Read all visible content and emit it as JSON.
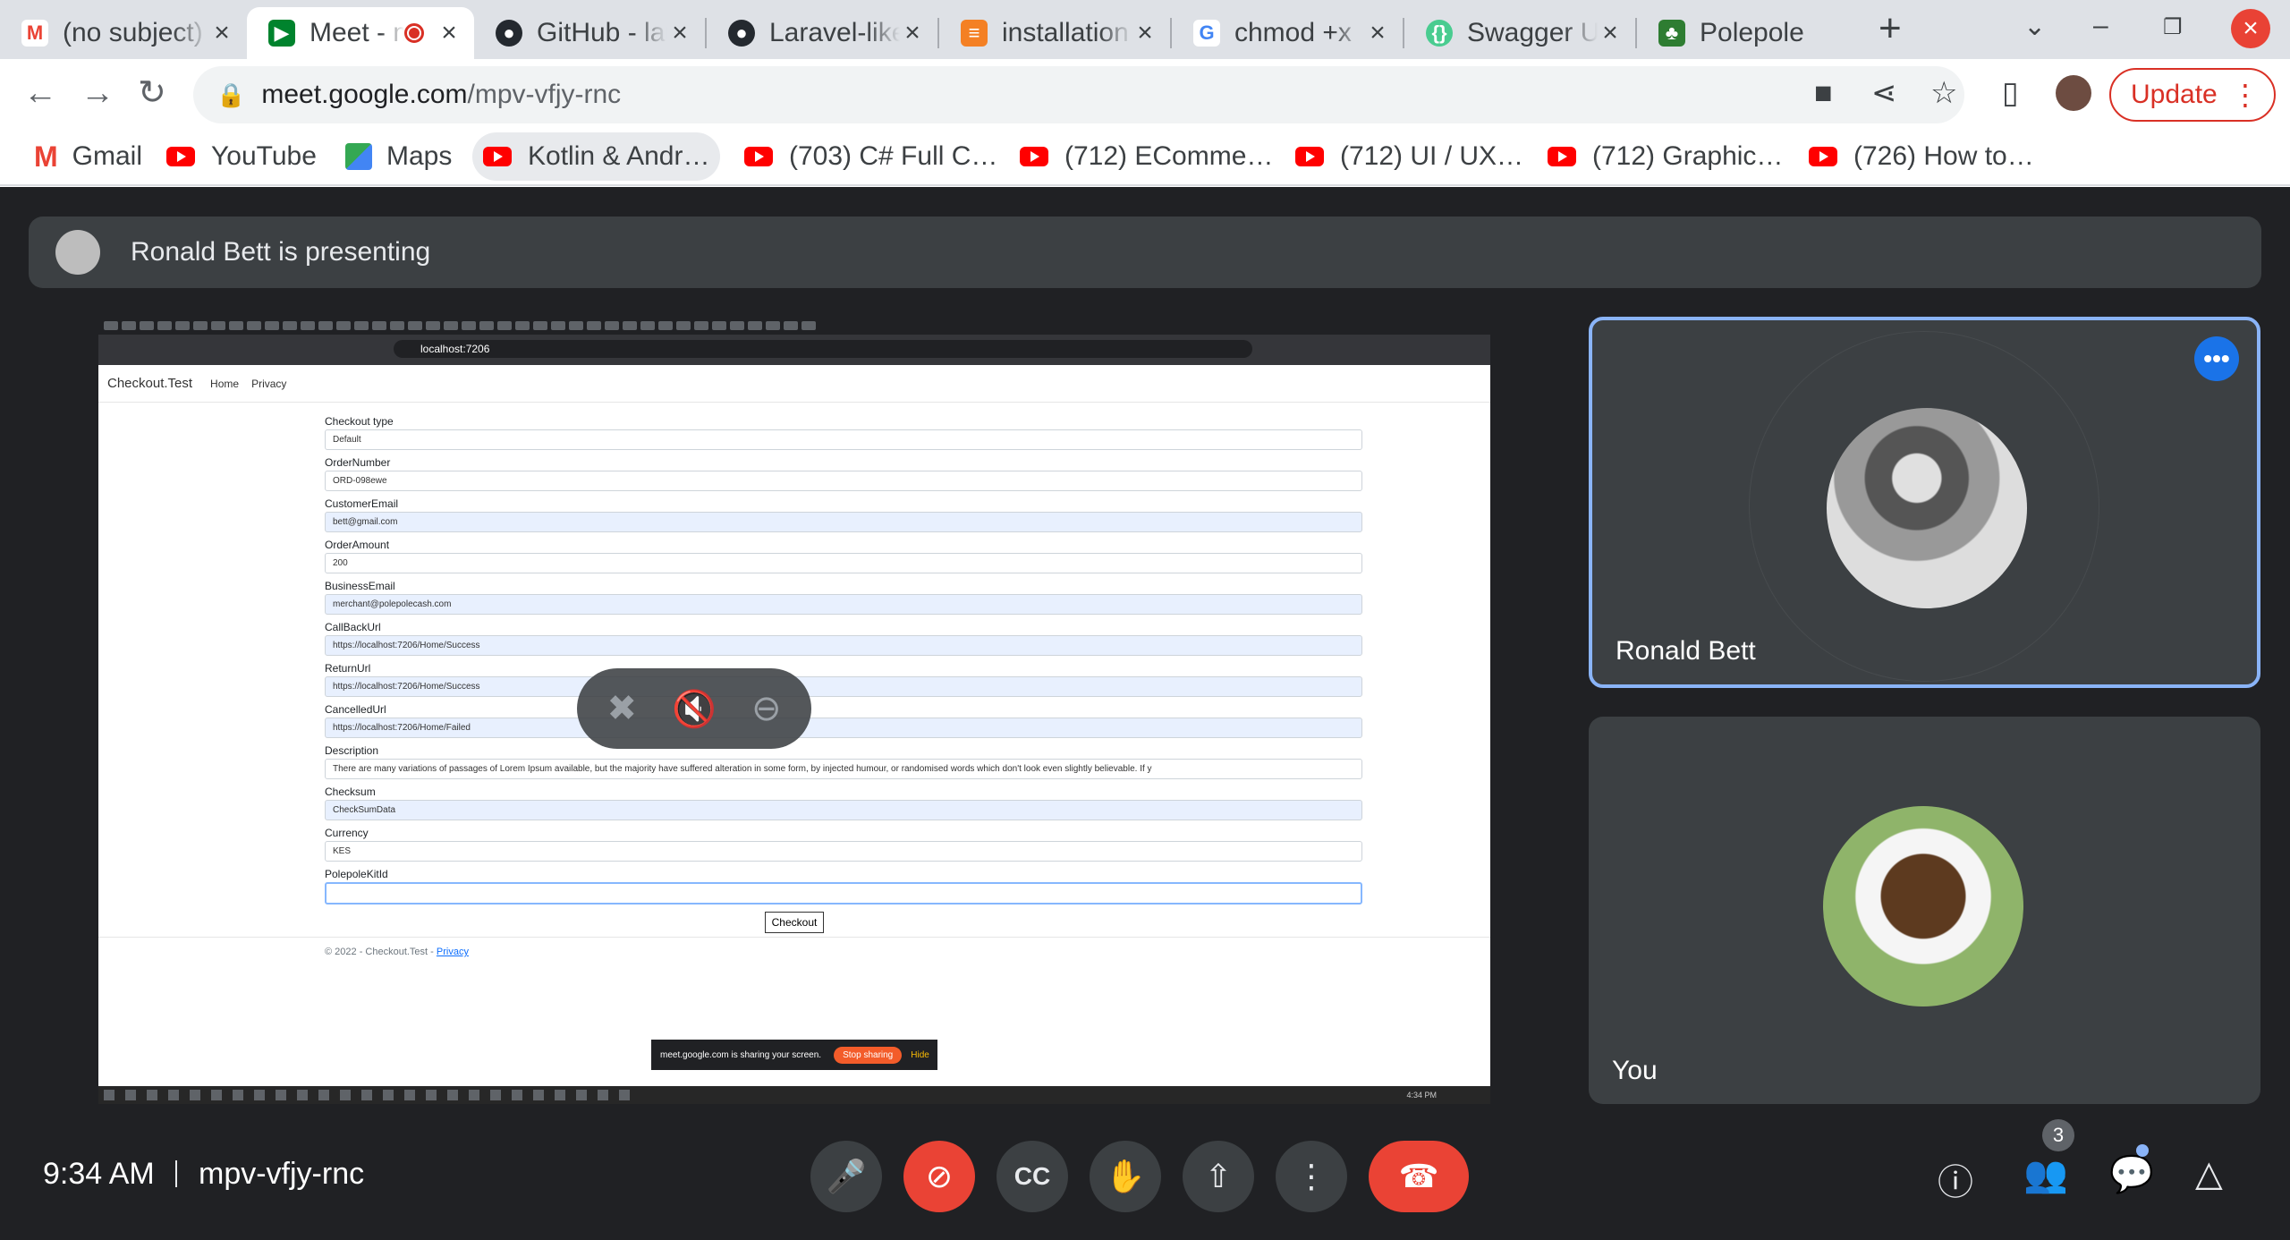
{
  "browser": {
    "tabs": [
      {
        "title": "(no subject)",
        "icon": "gmail-icon"
      },
      {
        "title": "Meet - mpv-vfjy-rnc",
        "icon": "meet-icon",
        "active": true
      },
      {
        "title": "GitHub - laravel",
        "icon": "github-icon"
      },
      {
        "title": "Laravel-like",
        "icon": "github-icon"
      },
      {
        "title": "installation",
        "icon": "stackoverflow-icon"
      },
      {
        "title": "chmod +x",
        "icon": "google-icon"
      },
      {
        "title": "Swagger UI",
        "icon": "swagger-icon"
      },
      {
        "title": "Polepole",
        "icon": "polepole-icon"
      }
    ],
    "url_host": "meet.google.com",
    "url_path": "/mpv-vfjy-rnc",
    "update_label": "Update",
    "bookmarks": [
      {
        "label": "Gmail",
        "icon": "gmail-icon"
      },
      {
        "label": "YouTube",
        "icon": "youtube-icon"
      },
      {
        "label": "Maps",
        "icon": "maps-icon"
      },
      {
        "label": "Kotlin & Andr…",
        "icon": "youtube-icon"
      },
      {
        "label": "(703) C# Full C…",
        "icon": "youtube-icon"
      },
      {
        "label": "(712) EComme…",
        "icon": "youtube-icon"
      },
      {
        "label": "(712) UI / UX…",
        "icon": "youtube-icon"
      },
      {
        "label": "(712) Graphic…",
        "icon": "youtube-icon"
      },
      {
        "label": "(726) How to…",
        "icon": "youtube-icon"
      }
    ]
  },
  "meet": {
    "presenting_text": "Ronald Bett is presenting",
    "shared": {
      "address": "localhost:7206",
      "brand": "Checkout.Test",
      "nav": [
        "Home",
        "Privacy"
      ],
      "fields": [
        {
          "label": "Checkout type",
          "value": "Default",
          "fill": false
        },
        {
          "label": "OrderNumber",
          "value": "ORD-098ewe",
          "fill": false
        },
        {
          "label": "CustomerEmail",
          "value": "bett@gmail.com",
          "fill": true
        },
        {
          "label": "OrderAmount",
          "value": "200",
          "fill": false
        },
        {
          "label": "BusinessEmail",
          "value": "merchant@polepolecash.com",
          "fill": true
        },
        {
          "label": "CallBackUrl",
          "value": "https://localhost:7206/Home/Success",
          "fill": true
        },
        {
          "label": "ReturnUrl",
          "value": "https://localhost:7206/Home/Success",
          "fill": true
        },
        {
          "label": "CancelledUrl",
          "value": "https://localhost:7206/Home/Failed",
          "fill": true
        },
        {
          "label": "Description",
          "value": "There are many variations of passages of Lorem Ipsum available, but the majority have suffered alteration in some form, by injected humour, or randomised words which don't look even slightly believable. If y",
          "fill": false
        },
        {
          "label": "Checksum",
          "value": "CheckSumData",
          "fill": true
        },
        {
          "label": "Currency",
          "value": "KES",
          "fill": false
        },
        {
          "label": "PolepoleKitId",
          "value": "",
          "fill": false
        }
      ],
      "checkout_button": "Checkout",
      "footer_text": "© 2022 - Checkout.Test - ",
      "footer_link": "Privacy",
      "sharing_text": "meet.google.com is sharing your screen.",
      "stop_sharing": "Stop sharing",
      "hide": "Hide",
      "taskbar_time": "4:34 PM"
    },
    "participants": [
      {
        "name": "Ronald Bett"
      },
      {
        "name": "You"
      }
    ],
    "time": "9:34 AM",
    "meeting_code": "mpv-vfjy-rnc",
    "people_count": "3"
  }
}
